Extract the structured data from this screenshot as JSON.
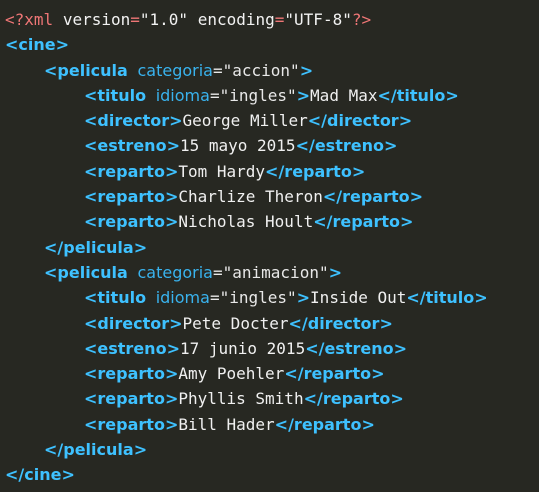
{
  "declaration": {
    "open": "<?",
    "name": "xml",
    "version_attr": "version",
    "version_val": "\"1.0\"",
    "encoding_attr": "encoding",
    "encoding_val": "\"UTF-8\"",
    "close": "?>"
  },
  "root_tag": "cine",
  "peliculas": [
    {
      "tag": "pelicula",
      "attr": "categoria",
      "attr_val": "\"accion\"",
      "titulo": {
        "tag": "titulo",
        "attr": "idioma",
        "attr_val": "\"ingles\"",
        "text": "Mad Max"
      },
      "director": {
        "tag": "director",
        "text": "George Miller"
      },
      "estreno": {
        "tag": "estreno",
        "text": "15 mayo 2015"
      },
      "reparto": [
        {
          "tag": "reparto",
          "text": "Tom Hardy"
        },
        {
          "tag": "reparto",
          "text": "Charlize Theron"
        },
        {
          "tag": "reparto",
          "text": "Nicholas Hoult"
        }
      ]
    },
    {
      "tag": "pelicula",
      "attr": "categoria",
      "attr_val": "\"animacion\"",
      "titulo": {
        "tag": "titulo",
        "attr": "idioma",
        "attr_val": "\"ingles\"",
        "text": "Inside Out"
      },
      "director": {
        "tag": "director",
        "text": "Pete Docter"
      },
      "estreno": {
        "tag": "estreno",
        "text": "17 junio 2015"
      },
      "reparto": [
        {
          "tag": "reparto",
          "text": "Amy Poehler"
        },
        {
          "tag": "reparto",
          "text": "Phyllis Smith"
        },
        {
          "tag": "reparto",
          "text": "Bill Hader"
        }
      ]
    }
  ],
  "colors": {
    "background": "#272822",
    "tag": "#3ec1ff",
    "attribute": "#39b3ee",
    "declaration_accent": "#ef7676",
    "text": "#f0f0f0"
  }
}
